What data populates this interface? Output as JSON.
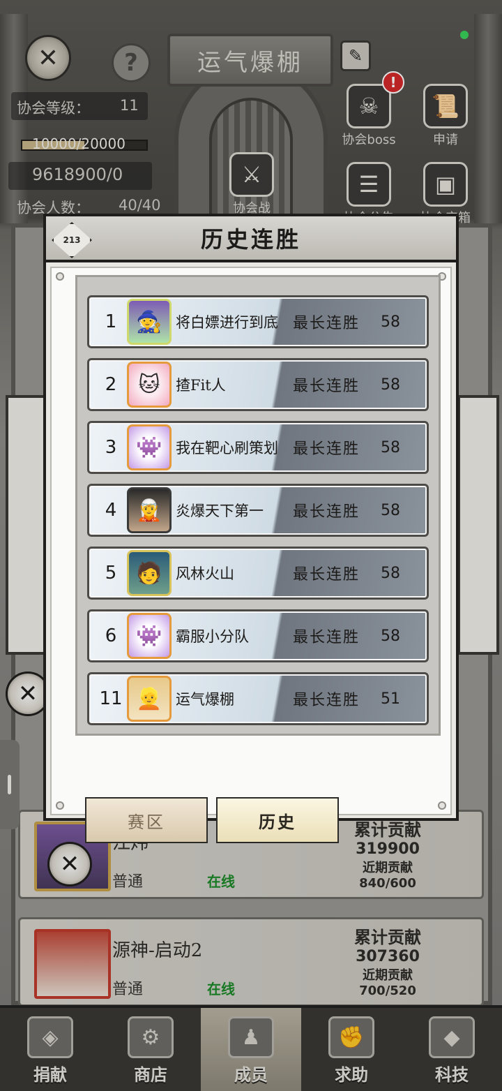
{
  "guild": {
    "name": "运气爆棚",
    "level_label": "协会等级：",
    "level_value": "11",
    "exp": "10000/20000",
    "exp_progress": 0.5,
    "funds": "9618900/0",
    "members_label": "协会人数：",
    "members_value": "40/40"
  },
  "top_menu": {
    "boss_label": "协会boss",
    "apply_label": "申请",
    "war_label": "协会战",
    "notice_label": "协会公告",
    "chest_label": "协会宝箱",
    "badge": "!"
  },
  "members": [
    {
      "name": "江炜",
      "role": "普通",
      "status": "在线",
      "total_label": "累计贡献",
      "total": "319900",
      "recent_label": "近期贡献",
      "recent": "840/600"
    },
    {
      "name": "源神-启动2",
      "role": "普通",
      "status": "在线",
      "total_label": "累计贡献",
      "total": "307360",
      "recent_label": "近期贡献",
      "recent": "700/520"
    }
  ],
  "modal": {
    "title": "历史连胜",
    "icon_text": "213",
    "streak_label": "最长连胜",
    "rows": [
      {
        "rank": "1",
        "name": "将白嫖进行到底",
        "value": "58",
        "avatar": "wizard"
      },
      {
        "rank": "2",
        "name": "揸Fit人",
        "value": "58",
        "avatar": "pink"
      },
      {
        "rank": "3",
        "name": "我在靶心刷策划",
        "value": "58",
        "avatar": "purple"
      },
      {
        "rank": "4",
        "name": "炎爆天下第一",
        "value": "58",
        "avatar": "dark"
      },
      {
        "rank": "5",
        "name": "风林火山",
        "value": "58",
        "avatar": "blue"
      },
      {
        "rank": "6",
        "name": "霸服小分队",
        "value": "58",
        "avatar": "purple"
      },
      {
        "rank": "11",
        "name": "运气爆棚",
        "value": "51",
        "avatar": "blond"
      }
    ],
    "tabs": {
      "region": "赛区",
      "history": "历史"
    }
  },
  "bottom_nav": [
    {
      "label": "捐献",
      "icon": "donate-icon",
      "active": false
    },
    {
      "label": "商店",
      "icon": "shop-icon",
      "active": false
    },
    {
      "label": "成员",
      "icon": "members-icon",
      "active": true
    },
    {
      "label": "求助",
      "icon": "help-fist-icon",
      "active": false
    },
    {
      "label": "科技",
      "icon": "tech-icon",
      "active": false
    }
  ]
}
